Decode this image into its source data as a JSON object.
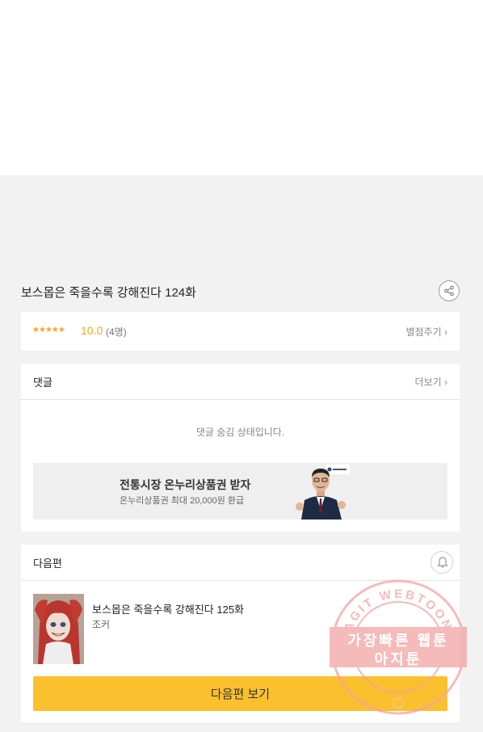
{
  "episode": {
    "title": "보스몹은 죽을수록 강해진다 124화",
    "share_icon": "share-icon"
  },
  "rating": {
    "stars": "★★★★★",
    "score": "10.0",
    "count": "(4명)",
    "rate_link": "별점주기 ›",
    "accent_color": "#f5a623"
  },
  "comments": {
    "label": "댓글",
    "more_link": "더보기 ›",
    "hidden_message": "댓글 숨김 상태입니다."
  },
  "ad": {
    "title": "전통시장 온누리상품권 받자",
    "subtitle": "온누리상품권 최대 20,000원 환급"
  },
  "next_episode": {
    "label": "다음편",
    "bell_icon": "bell-icon",
    "title": "보스몹은 죽을수록 강해진다 125화",
    "author": "조커",
    "button_label": "다음편 보기",
    "button_color": "#fbc02d"
  },
  "watermark": {
    "ring_text": "AGIT WEBTOON",
    "line1": "가장빠른 웹툰",
    "line2": "아지툰",
    "color": "#f2a3a3"
  }
}
